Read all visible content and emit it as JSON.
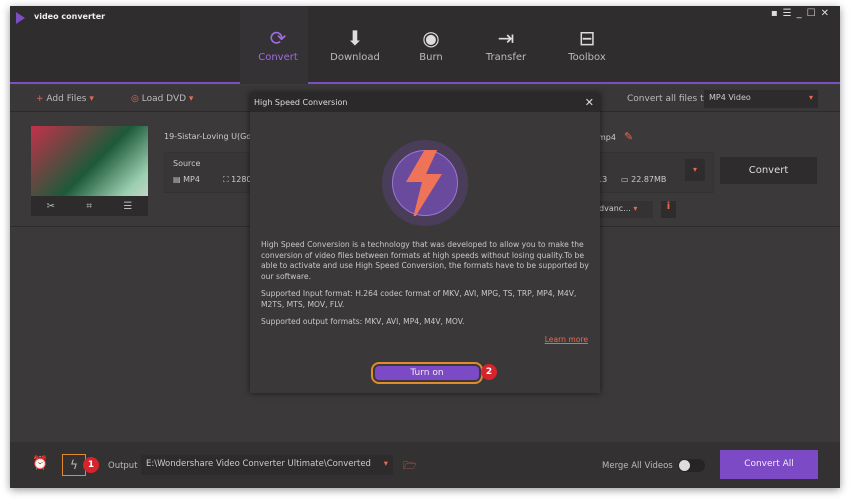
{
  "app": {
    "title": "video converter"
  },
  "window_controls": [
    "feedback-icon",
    "menu-icon",
    "minimize-icon",
    "maximize-icon",
    "close-icon"
  ],
  "tabs": [
    {
      "label": "Convert",
      "icon": "convert-icon",
      "active": true
    },
    {
      "label": "Download",
      "icon": "download-icon"
    },
    {
      "label": "Burn",
      "icon": "burn-icon"
    },
    {
      "label": "Transfer",
      "icon": "transfer-icon"
    },
    {
      "label": "Toolbox",
      "icon": "toolbox-icon"
    }
  ],
  "toolbar": {
    "add_files": "Add Files",
    "load_dvd": "Load DVD",
    "convert_all_label": "Convert all files to:",
    "format": "MP4 Video"
  },
  "file": {
    "name": "19-Sistar-Loving U(Gom",
    "source_label": "Source",
    "format": "MP4",
    "resolution": "1280",
    "target_ext": "mp4",
    "target_partial": "13",
    "size": "22.87MB",
    "advanced": "dvanc...",
    "convert": "Convert"
  },
  "dialog": {
    "title": "High Speed Conversion",
    "desc": "High Speed Conversion is a technology that was developed to allow you to make the conversion of video files between formats at high speeds without losing quality.To be able to activate and use High Speed Conversion, the formats have to be supported by our software.",
    "input": "Supported Input format: H.264 codec format of MKV, AVI, MPG, TS, TRP, MP4, M4V, M2TS, MTS, MOV, FLV.",
    "output": "Supported output formats: MKV, AVI, MP4, M4V, MOV.",
    "learn_more": "Learn more",
    "turn_on": "Turn on",
    "badge": "2"
  },
  "bottom": {
    "badge": "1",
    "output_label": "Output",
    "output_path": "E:\\Wondershare Video Converter Ultimate\\Converted",
    "merge_label": "Merge All Videos",
    "merge_on": false,
    "convert_all": "Convert All"
  },
  "colors": {
    "accent": "#7c4ac4",
    "highlight": "#e38a2d",
    "icon_red": "#e8694f",
    "badge": "#d7232b"
  }
}
